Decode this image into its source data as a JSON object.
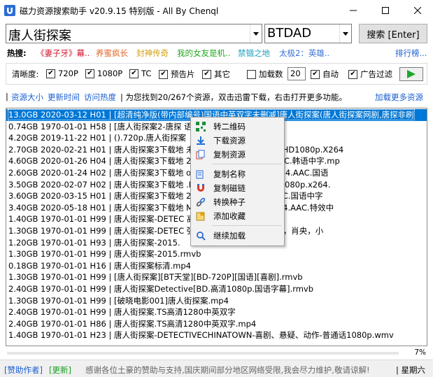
{
  "window": {
    "title": "磁力资源搜索助手 v20.9.15 特别版 - All By Chenql"
  },
  "search": {
    "query": "唐人街探案",
    "engine": "BTDAD",
    "button_label": "搜索 [Enter]"
  },
  "hot": {
    "label": "热搜:",
    "items": [
      {
        "text": "《妻子牙》幕..",
        "color": "#d4152b"
      },
      {
        "text": "养蜜疯长",
        "color": "#e0672a"
      },
      {
        "text": "封神传奇",
        "color": "#d1a112"
      },
      {
        "text": "我的女友是机..",
        "color": "#24a61f"
      },
      {
        "text": "禁锢之地",
        "color": "#1f9fc2"
      },
      {
        "text": "太极2：英雄..",
        "color": "#3a6fd6"
      }
    ],
    "more_label": "排行榜..."
  },
  "filters": {
    "clarity_label": "清晰度:",
    "options": [
      {
        "label": "720P",
        "checked": true
      },
      {
        "label": "1080P",
        "checked": true
      },
      {
        "label": "TC",
        "checked": true
      },
      {
        "label": "预告片",
        "checked": true
      },
      {
        "label": "其它",
        "checked": true
      }
    ],
    "load_count_label": "加载数",
    "load_count_checked": false,
    "load_count_value": "20",
    "auto_label": "自动",
    "auto_checked": true,
    "ad_filter_label": "广告过滤",
    "ad_filter_checked": true
  },
  "info": {
    "sep1": "|",
    "sort_size": "资源大小",
    "sort_time": "更新时间",
    "sort_heat": "访问热度",
    "message": "| 为您找到20/267个资源，双击迅雷下载，右击打开更多功能。",
    "load_more": "加载更多资源"
  },
  "results": [
    "13.0GB 2020-03-12 H01 | [超清纯净版(带内部编号)国语中英双字未删减]唐人街探案(唐人街探案网剧,唐探非刷",
    "0.74GB 1970-01-01 H58 | [唐人街探案2-唐探                  语中字][王宝强贺岁大片]",
    "4.20GB 2019-11-22 H01 | ().720p.唐人街探案",
    "2.70GB 2020-02-21 H01 | 唐人街探案3下载地                  未删减版).The.Imp.1996.HD1080p.X264",
    "4.60GB 2020-01-26 H04 | 唐人街探案3下载地                  2012.HD1080p.X264.AAC.韩语中字.mp",
    "2.60GB 2020-01-24 H02 | 唐人街探案3下载地                  ower.2019.HD1080P.X264.AAC.国语",
    "3.50GB 2020-02-07 H02 | 唐人街探案3下载地                  .Beautiful.2020.BluRay.1080p.x264.",
    "3.60GB 2020-03-15 H01 | 唐人街探案3下载地                  2019.HD1080P.X264.AAC.国语中字",
    "3.40GB 2020-05-18 H01 | 唐人街探案3下载地                  Man.2020.BD1080P.X264.AAC.特效中",
    "1.40GB 1970-01-01 H99 | 唐人街探案-DETEC                  高清1080p.rmvb",
    "1.30GB 1970-01-01 H99 | 唐人街探案-DETEC                  强，刘昊然，佟丽娅，陈赫，肖央，小",
    "1.20GB 1970-01-01 H93 | 唐人街探案-2015.",
    "1.30GB 1970-01-01 H99 | 唐人街探案-2015.rmvb",
    "0.18GB 1970-01-01 H16 | 唐人街探案标清.mp4",
    "1.30GB 1970-01-01 H99 | [唐人街探案][BT天堂][BD-720P][国语][喜剧].rmvb",
    "2.40GB 1970-01-01 H99 | 唐人街探案Detective[BD.高清1080p.国语字幕].rmvb",
    "1.30GB 1970-01-01 H99 | [破晓电影001]唐人街探案.mp4",
    "2.40GB 1970-01-01 H99 | 唐人街探案.TS高清1280中英双字",
    "2.40GB 1970-01-01 H86 | 唐人街探案.TS高清1280中英双字.mp4",
    "1.40GB 1970-01-01 H23 | 唐人街探案-DETECTIVECHINATOWN-喜剧、悬疑、动作-普通话1080p.wmv"
  ],
  "status": {
    "percent": "7%"
  },
  "bottom": {
    "sponsor": "[赞助作者]",
    "update": "[更新]",
    "notice": "感谢各位土豪的赞助与支持,国庆期间部分地区网络受限,我会尽力维护,敬请谅解!",
    "weekday": "| 星期六"
  },
  "context_menu": [
    {
      "label": "转二维码",
      "icon": "qrcode-icon"
    },
    {
      "label": "下载资源",
      "icon": "download-icon"
    },
    {
      "label": "复制资源",
      "icon": "copy-resource-icon"
    },
    {
      "label": "复制名称",
      "icon": "copy-name-icon"
    },
    {
      "label": "复制磁链",
      "icon": "magnet-icon"
    },
    {
      "label": "转换种子",
      "icon": "link-icon"
    },
    {
      "label": "添加收藏",
      "icon": "favorite-icon"
    },
    {
      "label": "继续加载",
      "icon": "load-more-icon"
    }
  ]
}
